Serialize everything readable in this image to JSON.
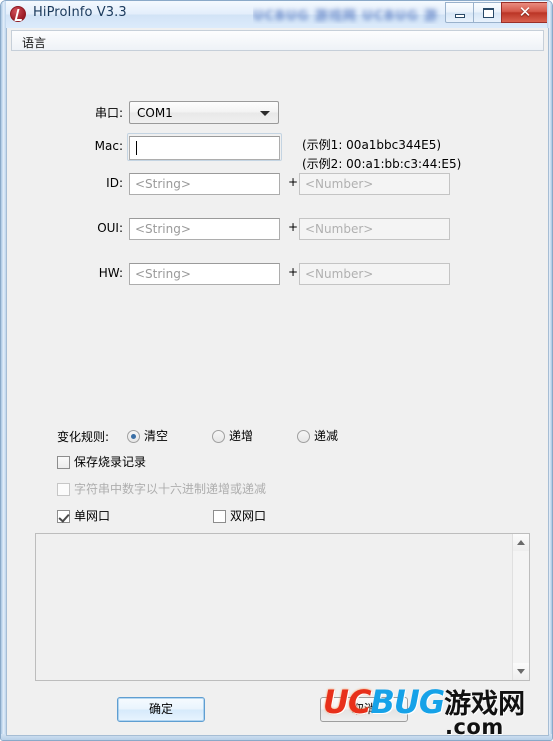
{
  "window": {
    "title": "HiProInfo V3.3",
    "icon": "app-logo-icon",
    "watermark_blurred": "UCBUG 游戏网 UCBUG 游戏网",
    "buttons": {
      "minimize": "minimize-icon",
      "maximize": "maximize-icon",
      "close": "✕"
    }
  },
  "menubar": {
    "items": [
      {
        "label": "语言"
      }
    ]
  },
  "form": {
    "fields": [
      {
        "label": "串口:",
        "type": "combobox",
        "value": "COM1",
        "arrow": "chevron-down-icon"
      },
      {
        "label": "Mac:",
        "type": "text",
        "value": "",
        "placeholder": "",
        "focused": true
      },
      {
        "label": "ID:",
        "type": "text-pair",
        "string_placeholder": "<String>",
        "operator": "+",
        "number_placeholder": "<Number>"
      },
      {
        "label": "OUI:",
        "type": "text-pair",
        "string_placeholder": "<String>",
        "operator": "+",
        "number_placeholder": "<Number>"
      },
      {
        "label": "HW:",
        "type": "text-pair",
        "string_placeholder": "<String>",
        "operator": "+",
        "number_placeholder": "<Number>"
      }
    ],
    "hints": [
      "(示例1: 00a1bbc344E5)",
      "(示例2: 00:a1:bb:c3:44:E5)"
    ]
  },
  "options": {
    "rule_label": "变化规则:",
    "radios": [
      {
        "label": "清空",
        "checked": true
      },
      {
        "label": "递增",
        "checked": false
      },
      {
        "label": "递减",
        "checked": false
      }
    ],
    "checkboxes": [
      {
        "label": "保存烧录记录",
        "checked": false,
        "disabled": false
      },
      {
        "label": "字符串中数字以十六进制递增或递减",
        "checked": false,
        "disabled": true
      },
      {
        "label": "单网口",
        "checked": true,
        "disabled": false
      },
      {
        "label": "双网口",
        "checked": false,
        "disabled": false
      }
    ]
  },
  "log": {
    "content": "",
    "scrollbar": {
      "up": "scroll-up-icon",
      "down": "scroll-down-icon"
    }
  },
  "footer": {
    "ok_label": "确定",
    "cancel_label": "取消"
  },
  "site_watermark": {
    "uc": "UC",
    "bug": "BUG",
    "cn": "游戏网",
    "tld": ".com"
  },
  "colors": {
    "accent_blue": "#3a6ea5",
    "close_red": "#bb3526",
    "logo_red": "#e8301a",
    "logo_blue": "#16a2e8",
    "window_bg": "#f0f0f0"
  }
}
